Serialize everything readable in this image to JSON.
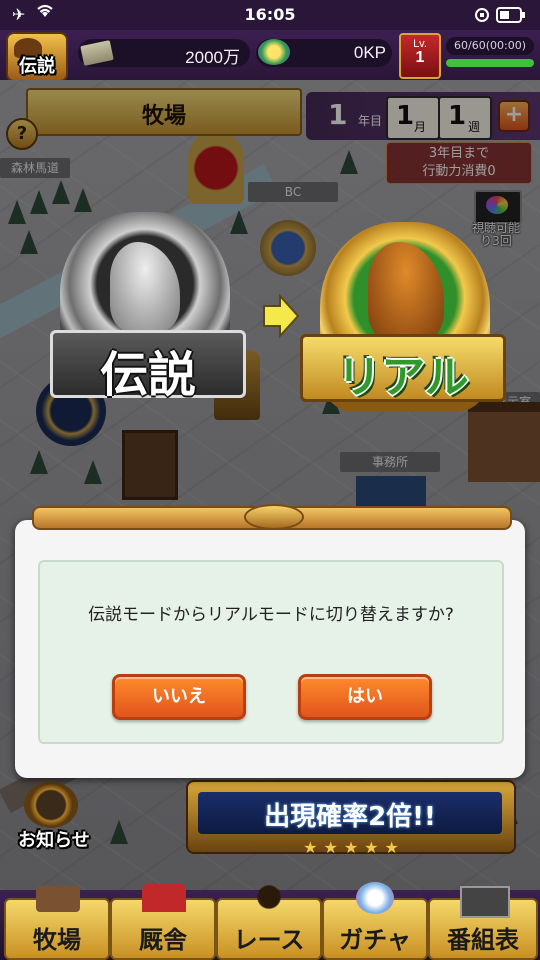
{
  "status_bar": {
    "time": "16:05"
  },
  "hud": {
    "mode_badge": "伝説",
    "money": "2000万",
    "kp": "0KP",
    "level_label": "Lv.",
    "level_value": "1",
    "stamina": "60/60(00:00)"
  },
  "location": {
    "title": "牧場"
  },
  "date": {
    "year": "1",
    "year_unit": "年目",
    "month": "1",
    "month_unit": "月",
    "week": "1",
    "week_unit": "週"
  },
  "help_label": "?",
  "plus_label": "+",
  "notice": {
    "line1": "3年目まで",
    "line2": "行動力消費0"
  },
  "video": {
    "line1": "視聴可能",
    "line2": "り3回"
  },
  "map_labels": {
    "road": "森林馬道",
    "bc": "BC",
    "showroom": "展示室",
    "office": "事務所"
  },
  "mode_switch": {
    "from": "伝説",
    "to": "リアル"
  },
  "dialog": {
    "message": "伝説モードからリアルモードに切り替えますか?",
    "no_label": "いいえ",
    "yes_label": "はい"
  },
  "news_label": "お知らせ",
  "banner": {
    "text": "出現確率2倍!!"
  },
  "nav": [
    {
      "label": "牧場"
    },
    {
      "label": "厩舎"
    },
    {
      "label": "レース"
    },
    {
      "label": "ガチャ"
    },
    {
      "label": "番組表"
    }
  ],
  "colors": {
    "accent": "#e0551c",
    "hud_bg": "#2a1638",
    "gold": "#d6a335",
    "green_badge": "#2f8f2a"
  }
}
